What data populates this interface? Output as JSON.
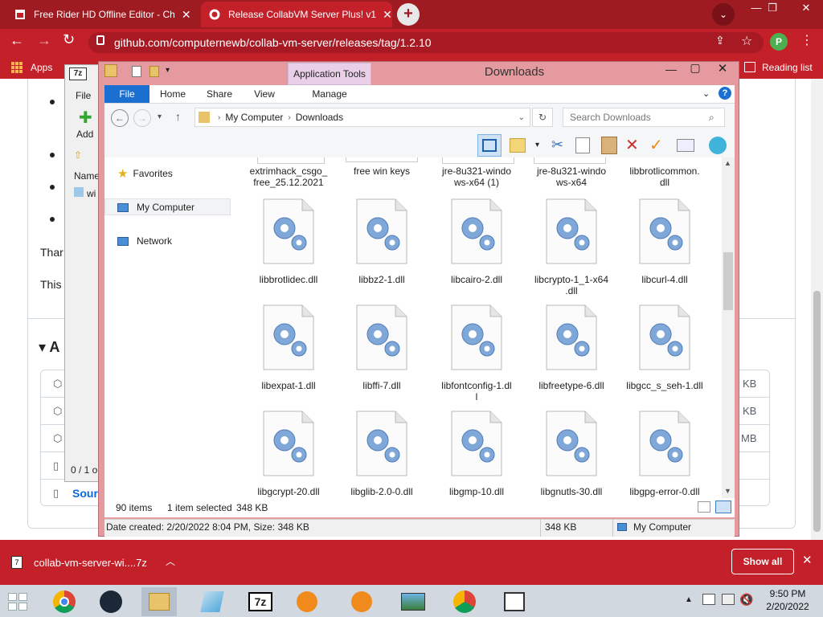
{
  "browser": {
    "tabs": [
      {
        "label": "Free Rider HD Offline Editor - Ch",
        "active": false
      },
      {
        "label": "Release CollabVM Server Plus! v1",
        "active": true
      }
    ],
    "url": "github.com/computernewb/collab-vm-server/releases/tag/1.2.10",
    "profile_initial": "P",
    "bookmarks": {
      "apps": "Apps",
      "reading_list": "Reading list"
    }
  },
  "page": {
    "text_fragments": [
      "Thar",
      "This"
    ],
    "assets_heading": "A",
    "asset_sizes": [
      "KB",
      "KB",
      "MB"
    ],
    "source_label": "Sourc"
  },
  "sevenzip": {
    "menu_file": "File",
    "add_label": "Add",
    "column_name": "Name",
    "row_text": "wi",
    "status": "0 / 1 o"
  },
  "explorer": {
    "title": "Downloads",
    "app_tools": "Application Tools",
    "ribbon_tabs": [
      "File",
      "Home",
      "Share",
      "View",
      "Manage"
    ],
    "breadcrumb": [
      "My Computer",
      "Downloads"
    ],
    "search_placeholder": "Search Downloads",
    "nav": {
      "favorites": "Favorites",
      "my_computer": "My Computer",
      "network": "Network"
    },
    "top_row": [
      {
        "name": "extrimhack_csgo_\nfree_25.12.2021"
      },
      {
        "name": "free win keys"
      },
      {
        "name": "jre-8u321-windo\nws-x64 (1)"
      },
      {
        "name": "jre-8u321-windo\nws-x64"
      },
      {
        "name": "libbrotlicommon.\ndll"
      }
    ],
    "files": [
      "libbrotlidec.dll",
      "libbz2-1.dll",
      "libcairo-2.dll",
      "libcrypto-1_1-x64\n.dll",
      "libcurl-4.dll",
      "libexpat-1.dll",
      "libffi-7.dll",
      "libfontconfig-1.dl\nl",
      "libfreetype-6.dll",
      "libgcc_s_seh-1.dll",
      "libgcrypt-20.dll",
      "libglib-2.0-0.dll",
      "libgmp-10.dll",
      "libgnutls-30.dll",
      "libgpg-error-0.dll"
    ],
    "status": {
      "items": "90 items",
      "selected": "1 item selected",
      "size": "348 KB"
    },
    "details": {
      "info": "Date created: 2/20/2022 8:04 PM, Size: 348 KB",
      "size": "348 KB",
      "location": "My Computer"
    }
  },
  "downloads_bar": {
    "file": "collab-vm-server-wi....7z",
    "show_all": "Show all"
  },
  "taskbar": {
    "time": "9:50 PM",
    "date": "2/20/2022"
  }
}
